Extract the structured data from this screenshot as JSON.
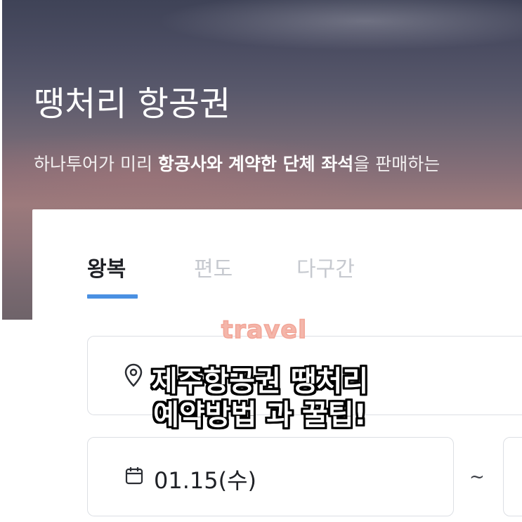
{
  "hero": {
    "title": "땡처리 항공권",
    "subtitle_parts": {
      "p1": "하나투어가 미리 ",
      "b1": "항공사와",
      "p2": " ",
      "b2": "계약한 단체 좌석",
      "p3": "을 판매하는"
    }
  },
  "tabs": [
    {
      "label": "왕복",
      "active": true
    },
    {
      "label": "편도",
      "active": false
    },
    {
      "label": "다구간",
      "active": false
    }
  ],
  "search": {
    "destination_icon": "map-pin-icon",
    "date_icon": "calendar-icon",
    "date_from": "01.15(수)",
    "date_separator": "~"
  },
  "overlay": {
    "tag": "travel",
    "line1": "제주항공권 땡처리",
    "line2": "예약방법 과 꿀팁!"
  },
  "colors": {
    "accent": "#4a90e2",
    "tab_active": "#1f2126",
    "tab_inactive": "#c6c9cf",
    "overlay_tag": "#f4b6aa"
  }
}
